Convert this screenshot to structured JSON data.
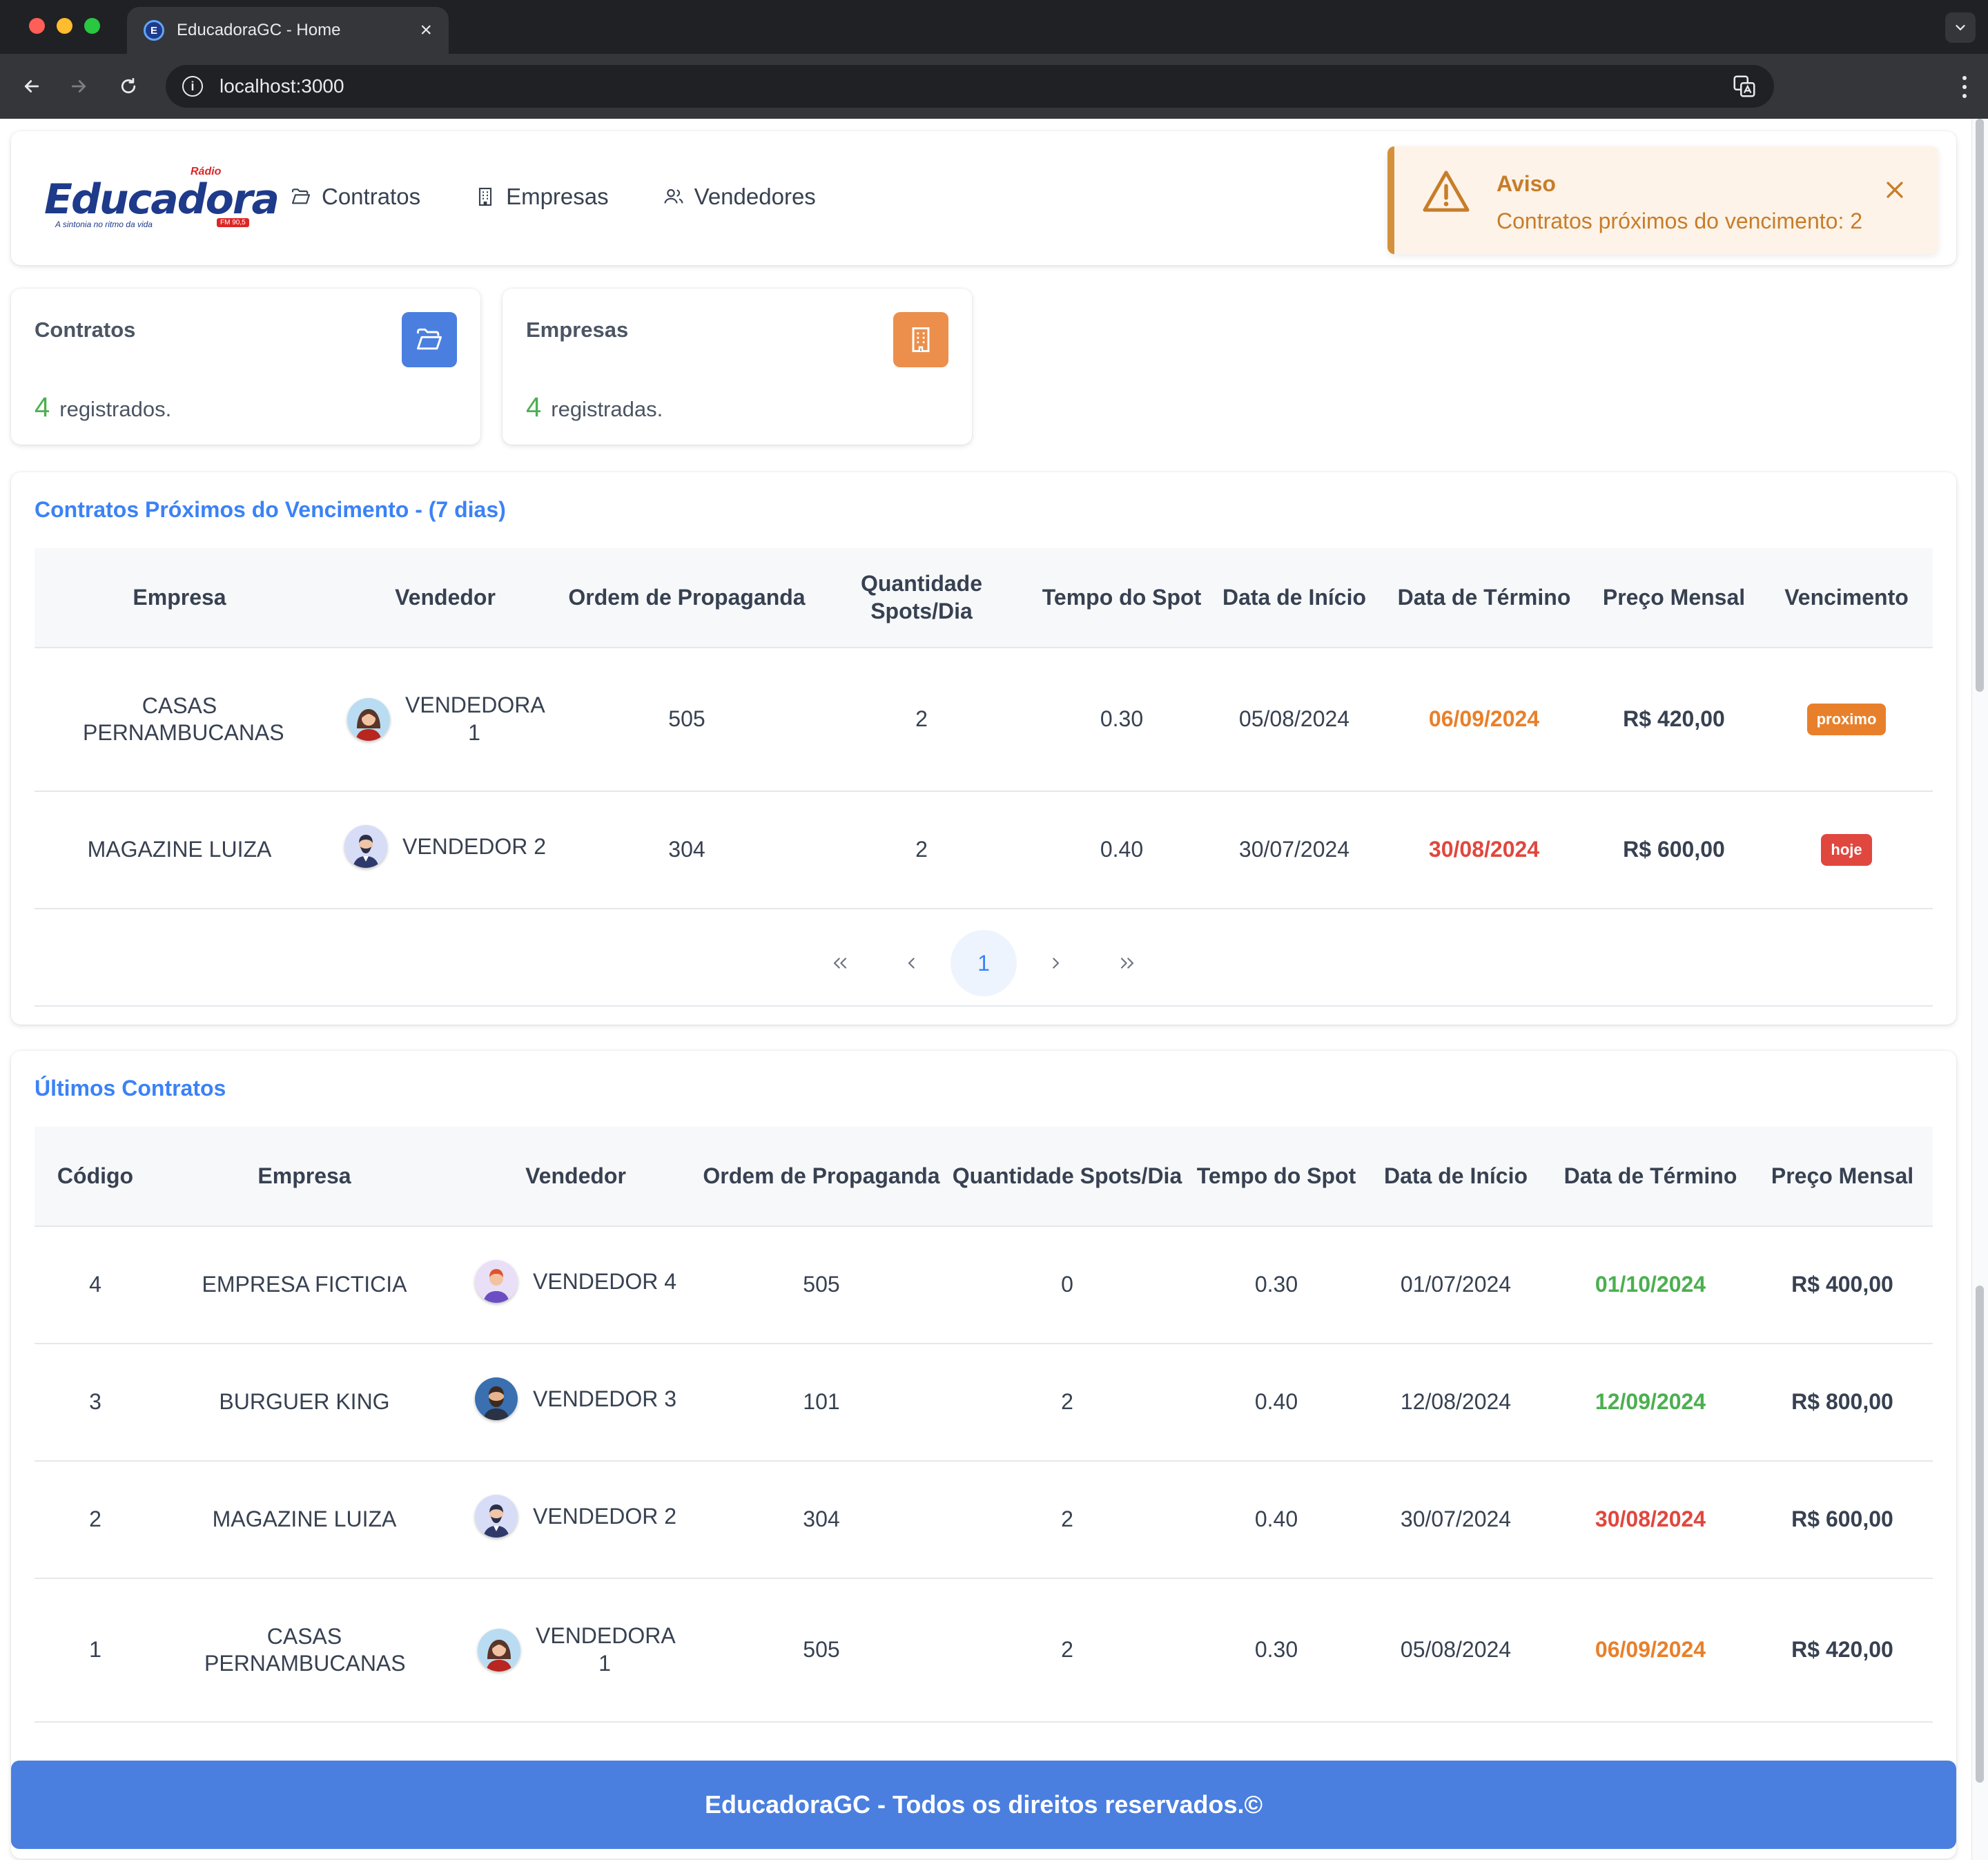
{
  "browser": {
    "tab_title": "EducadoraGC - Home",
    "url": "localhost:3000",
    "favicon_letter": "E"
  },
  "header": {
    "logo": {
      "radio": "Rádio",
      "word": "Educadora",
      "slogan": "A sintonia no ritmo da vida",
      "fm": "FM 90,5"
    },
    "menu": [
      {
        "label": "Contratos",
        "icon": "folder-open-icon"
      },
      {
        "label": "Empresas",
        "icon": "building-icon"
      },
      {
        "label": "Vendedores",
        "icon": "users-icon"
      }
    ],
    "toast": {
      "title": "Aviso",
      "message": "Contratos próximos do vencimento: 2",
      "color": "#d4913a"
    }
  },
  "stats": [
    {
      "title": "Contratos",
      "count": "4",
      "label": "registrados.",
      "icon": "folder-open-icon",
      "icon_color": "#4a7fe0"
    },
    {
      "title": "Empresas",
      "count": "4",
      "label": "registradas.",
      "icon": "building-icon",
      "icon_color": "#ec8f4c"
    }
  ],
  "proximos": {
    "title": "Contratos Próximos do Vencimento - (7 dias)",
    "columns": [
      "Empresa",
      "Vendedor",
      "Ordem de Propaganda",
      "Quantidade Spots/Dia",
      "Tempo do Spot",
      "Data de Início",
      "Data de Término",
      "Preço Mensal",
      "Vencimento"
    ],
    "rows": [
      {
        "empresa": "CASAS PERNAMBUCANAS",
        "vendedor": "VENDEDORA 1",
        "ordem": "505",
        "spots": "2",
        "tempo": "0.30",
        "inicio": "05/08/2024",
        "termino": "06/09/2024",
        "preco": "R$ 420,00",
        "vencimento": "proximo"
      },
      {
        "empresa": "MAGAZINE LUIZA",
        "vendedor": "VENDEDOR 2",
        "ordem": "304",
        "spots": "2",
        "tempo": "0.40",
        "inicio": "30/07/2024",
        "termino": "30/08/2024",
        "preco": "R$ 600,00",
        "vencimento": "hoje"
      }
    ],
    "pagination": {
      "first": "«",
      "prev": "‹",
      "current": "1",
      "next": "›",
      "last": "»"
    }
  },
  "ultimos": {
    "title": "Últimos Contratos",
    "columns": [
      "Código",
      "Empresa",
      "Vendedor",
      "Ordem de Propaganda",
      "Quantidade Spots/Dia",
      "Tempo do Spot",
      "Data de Início",
      "Data de Término",
      "Preço Mensal"
    ],
    "rows": [
      {
        "codigo": "4",
        "empresa": "EMPRESA FICTICIA",
        "vendedor": "VENDEDOR 4",
        "ordem": "505",
        "spots": "0",
        "tempo": "0.30",
        "inicio": "01/07/2024",
        "termino": "01/10/2024",
        "preco": "R$ 400,00"
      },
      {
        "codigo": "3",
        "empresa": "BURGUER KING",
        "vendedor": "VENDEDOR 3",
        "ordem": "101",
        "spots": "2",
        "tempo": "0.40",
        "inicio": "12/08/2024",
        "termino": "12/09/2024",
        "preco": "R$ 800,00"
      },
      {
        "codigo": "2",
        "empresa": "MAGAZINE LUIZA",
        "vendedor": "VENDEDOR 2",
        "ordem": "304",
        "spots": "2",
        "tempo": "0.40",
        "inicio": "30/07/2024",
        "termino": "30/08/2024",
        "preco": "R$ 600,00"
      },
      {
        "codigo": "1",
        "empresa": "CASAS PERNAMBUCANAS",
        "vendedor": "VENDEDORA 1",
        "ordem": "505",
        "spots": "2",
        "tempo": "0.30",
        "inicio": "05/08/2024",
        "termino": "06/09/2024",
        "preco": "R$ 420,00"
      }
    ]
  },
  "footer": {
    "text": "EducadoraGC - Todos os direitos reservados.©"
  },
  "colors": {
    "primary": "#4a7fe0",
    "title_blue": "#3b82f6",
    "green": "#4caf50",
    "orange": "#e8802b",
    "red": "#e0473e"
  }
}
